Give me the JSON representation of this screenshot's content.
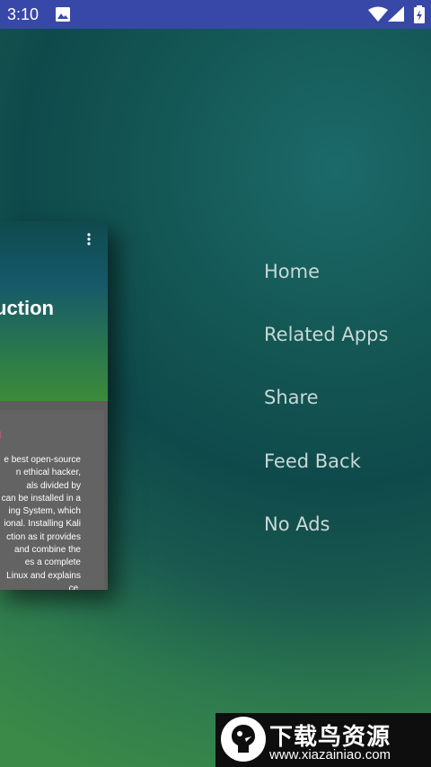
{
  "status_bar": {
    "time": "3:10",
    "icons": [
      "image-icon",
      "wifi-icon",
      "signal-icon",
      "battery-icon"
    ]
  },
  "card": {
    "title": "uction",
    "subtitle": "al",
    "more_icon": "more-vert-icon",
    "body_lines": [
      "e best open-source",
      "n ethical hacker,",
      "als divided by",
      "can be installed in a",
      "ing System, which",
      "ional. Installing Kali",
      "ction as it provides",
      "and combine the",
      "es a complete",
      "Linux and explains",
      "ce."
    ]
  },
  "menu": {
    "items": [
      {
        "label": "Home"
      },
      {
        "label": "Related Apps"
      },
      {
        "label": "Share"
      },
      {
        "label": "Feed Back"
      },
      {
        "label": "No Ads"
      }
    ]
  },
  "watermark": {
    "title": "下载鸟资源",
    "url": "www.xiazainiao.com"
  }
}
